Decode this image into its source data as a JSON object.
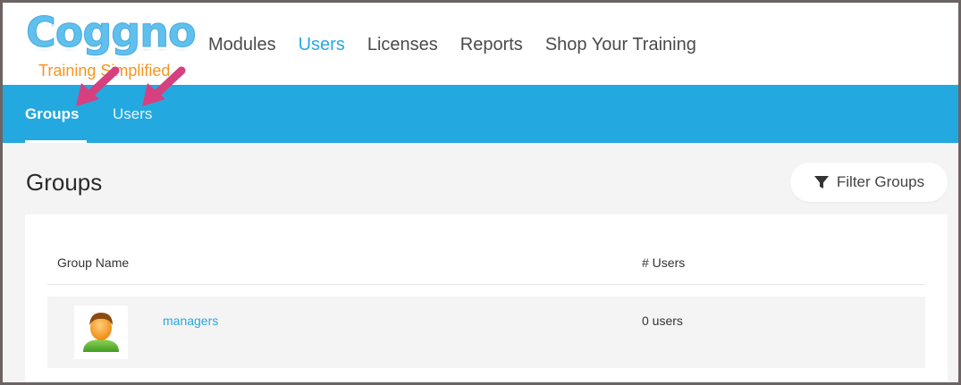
{
  "logo": {
    "word": "Coggno",
    "tagline": "Training Simplified"
  },
  "main_nav": [
    {
      "label": "Modules",
      "active": false
    },
    {
      "label": "Users",
      "active": true
    },
    {
      "label": "Licenses",
      "active": false
    },
    {
      "label": "Reports",
      "active": false
    },
    {
      "label": "Shop Your Training",
      "active": false
    }
  ],
  "sub_nav": [
    {
      "label": "Groups",
      "active": true
    },
    {
      "label": "Users",
      "active": false
    }
  ],
  "page": {
    "title": "Groups",
    "filter_label": "Filter Groups"
  },
  "table": {
    "headers": [
      "Group Name",
      "# Users"
    ],
    "rows": [
      {
        "name": "managers",
        "users": "0 users"
      }
    ]
  },
  "colors": {
    "brand_blue": "#24a8e0",
    "accent_link": "#2aa7de",
    "tagline_orange": "#f7941d",
    "arrow_pink": "#d6407f"
  },
  "icons": {
    "filter": "funnel-icon",
    "group_avatar": "person-avatar-icon",
    "arrow": "annotation-arrow-icon"
  }
}
